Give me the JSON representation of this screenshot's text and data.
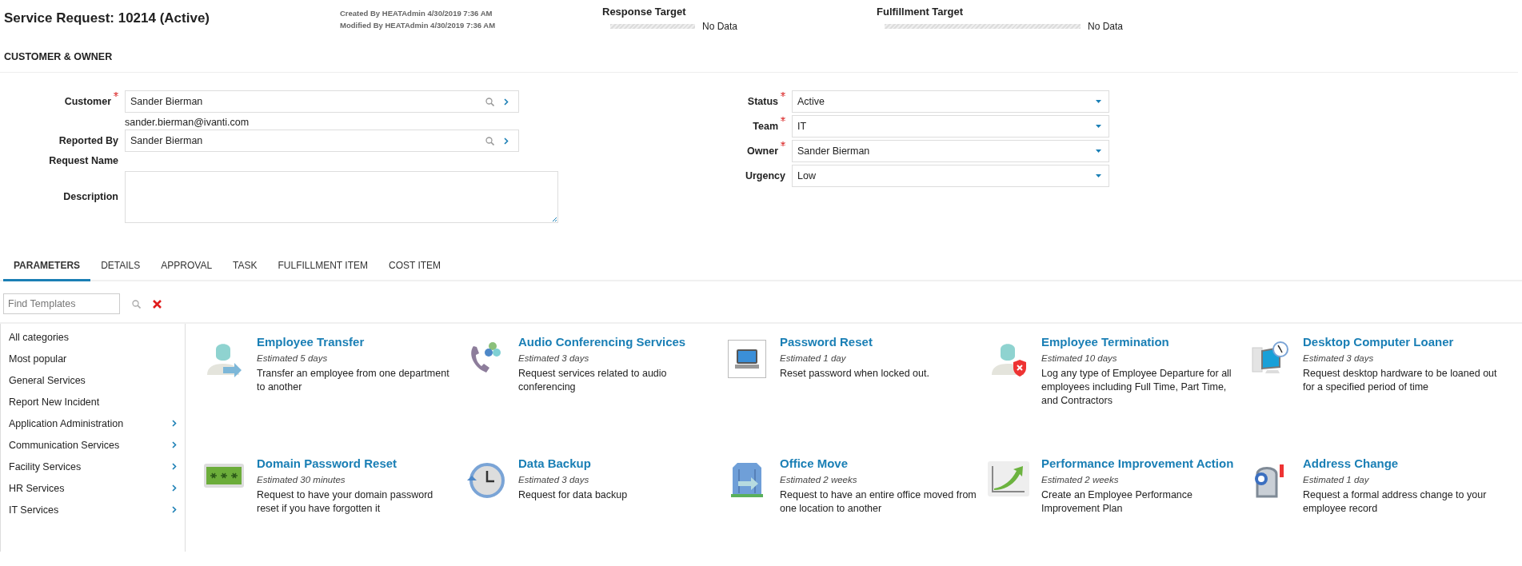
{
  "header": {
    "title": "Service Request: 10214 (Active)",
    "created": "Created By HEATAdmin 4/30/2019 7:36 AM",
    "modified": "Modified By HEATAdmin 4/30/2019 7:36 AM",
    "targets": [
      {
        "label": "Response Target",
        "level": 0,
        "value": "No Data"
      },
      {
        "label": "Fulfillment Target",
        "level": 0,
        "value": "No Data"
      }
    ]
  },
  "section_title": "CUSTOMER & OWNER",
  "left_fields": [
    {
      "kind": "lookup",
      "label": "Customer",
      "required": true,
      "value": "Sander Bierman",
      "note": "sander.bierman@ivanti.com"
    },
    {
      "kind": "lookup",
      "label": "Reported By",
      "required": false,
      "value": "Sander Bierman"
    },
    {
      "kind": "text",
      "label": "Request Name",
      "required": false
    },
    {
      "kind": "textarea",
      "label": "Description",
      "required": false
    }
  ],
  "right_fields": [
    {
      "label": "Status",
      "required": true,
      "value": "Active"
    },
    {
      "label": "Team",
      "required": true,
      "value": "IT"
    },
    {
      "label": "Owner",
      "required": true,
      "value": "Sander Bierman"
    },
    {
      "label": "Urgency",
      "required": false,
      "value": "Low"
    }
  ],
  "tabs": [
    {
      "label": "PARAMETERS",
      "selected": true
    },
    {
      "label": "DETAILS",
      "selected": false
    },
    {
      "label": "APPROVAL",
      "selected": false
    },
    {
      "label": "TASK",
      "selected": false
    },
    {
      "label": "FULFILLMENT ITEM",
      "selected": false
    },
    {
      "label": "COST ITEM",
      "selected": false
    }
  ],
  "search": {
    "placeholder": "Find Templates"
  },
  "categories": [
    {
      "label": "All categories",
      "has_children": false
    },
    {
      "label": "Most popular",
      "has_children": false
    },
    {
      "label": "General Services",
      "has_children": false
    },
    {
      "label": "Report New Incident",
      "has_children": false
    },
    {
      "label": "Application Administration",
      "has_children": true
    },
    {
      "label": "Communication Services",
      "has_children": true
    },
    {
      "label": "Facility Services",
      "has_children": true
    },
    {
      "label": "HR Services",
      "has_children": true
    },
    {
      "label": "IT Services",
      "has_children": true
    }
  ],
  "templates": [
    {
      "kind": "person-arrow",
      "title": "Employee Transfer",
      "estimate": "Estimated 5 days",
      "description": "Transfer an employee from one department to another"
    },
    {
      "kind": "phone",
      "title": "Audio Conferencing Services",
      "estimate": "Estimated 3 days",
      "description": "Request services related to audio conferencing"
    },
    {
      "kind": "monitor",
      "title": "Password Reset",
      "estimate": "Estimated 1 day",
      "description": "Reset password when locked out."
    },
    {
      "kind": "person-shield",
      "title": "Employee Termination",
      "estimate": "Estimated 10 days",
      "description": "Log any type of Employee Departure for all employees including Full Time, Part Time, and Contractors"
    },
    {
      "kind": "computer",
      "title": "Desktop Computer Loaner",
      "estimate": "Estimated 3 days",
      "description": "Request desktop hardware to be loaned out for a specified period of time"
    },
    {
      "kind": "password",
      "title": "Domain Password Reset",
      "estimate": "Estimated 30 minutes",
      "description": "Request to have your domain password reset if you have forgotten it"
    },
    {
      "kind": "clock",
      "title": "Data Backup",
      "estimate": "Estimated 3 days",
      "description": "Request for data backup"
    },
    {
      "kind": "building",
      "title": "Office Move",
      "estimate": "Estimated 2 weeks",
      "description": "Request to have an entire office moved from one location to another"
    },
    {
      "kind": "chart",
      "title": "Performance Improvement Action",
      "estimate": "Estimated 2 weeks",
      "description": "Create an Employee Performance Improvement Plan"
    },
    {
      "kind": "mailbox",
      "title": "Address Change",
      "estimate": "Estimated 1 day",
      "description": "Request a formal address change to your employee record"
    }
  ]
}
